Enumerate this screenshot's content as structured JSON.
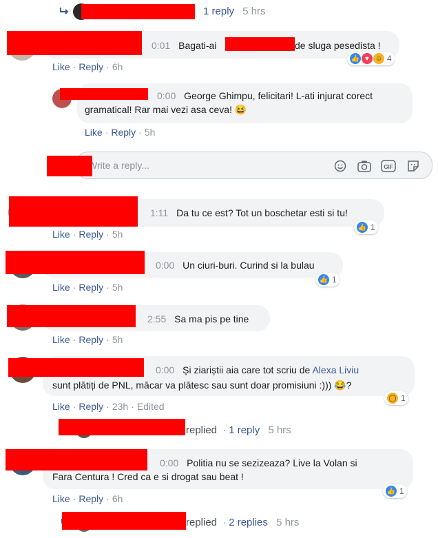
{
  "top_reply": {
    "reply_count": "1 reply",
    "time": "5 hrs"
  },
  "comments": [
    {
      "duration": "0:01",
      "text_before": "Bagati-ai",
      "text_after": "de sluga pesedista !",
      "actions": {
        "like": "Like",
        "reply": "Reply",
        "time": "6h"
      },
      "reaction_count": "4"
    },
    {
      "duration": "0:00",
      "text_line1": "George Ghimpu, felicitari! L-ati injurat corect",
      "text_line2": "gramatical! Rar mai vezi asa ceva! 😆",
      "actions": {
        "like": "Like",
        "reply": "Reply",
        "time": "5h"
      }
    },
    {
      "duration": "1:11",
      "text": "Da tu ce est? Tot un boschetar esti si tu!",
      "actions": {
        "like": "Like",
        "reply": "Reply",
        "time": "5h"
      },
      "reaction_count": "1"
    },
    {
      "duration": "0:00",
      "text": "Un ciuri-buri. Curind si la bulau",
      "actions": {
        "like": "Like",
        "reply": "Reply",
        "time": "5h"
      },
      "reaction_count": "1"
    },
    {
      "duration": "2:55",
      "text": "Sa ma pis pe tine",
      "actions": {
        "like": "Like",
        "reply": "Reply",
        "time": "5h"
      }
    },
    {
      "duration": "0:00",
      "text_before": "Și ziariștii aia care tot scriu de",
      "mention": "Alexa Liviu",
      "text_line2": "sunt plătiți de PNL, măcar va plătesc sau sunt doar promisiuni :))) 😂?",
      "actions": {
        "like": "Like",
        "reply": "Reply",
        "time": "23h",
        "edited": "Edited"
      },
      "reaction_count": "1"
    },
    {
      "duration": "0:00",
      "text_line1": "Politia nu se sezizeaza? Live la Volan si",
      "text_line2": "Fara Centura ! Cred ca e si drogat sau beat !",
      "actions": {
        "like": "Like",
        "reply": "Reply",
        "time": "6h"
      },
      "reaction_count": "1"
    }
  ],
  "write_reply": {
    "placeholder": "Write a reply..."
  },
  "replied_row_1": {
    "replied": "replied",
    "count": "1 reply",
    "time": "5 hrs"
  },
  "replied_row_2": {
    "replied": "replied",
    "count": "2 replies",
    "time": "5 hrs"
  },
  "colors": {
    "link": "#385898",
    "bubble": "#f2f3f5",
    "redaction": "#ff0000",
    "meta": "#90949c"
  },
  "icons": [
    "reply-arrow-icon",
    "emoji-icon",
    "camera-icon",
    "gif-icon",
    "sticker-icon",
    "like-reaction-icon",
    "love-reaction-icon",
    "haha-reaction-icon",
    "wow-reaction-icon"
  ]
}
